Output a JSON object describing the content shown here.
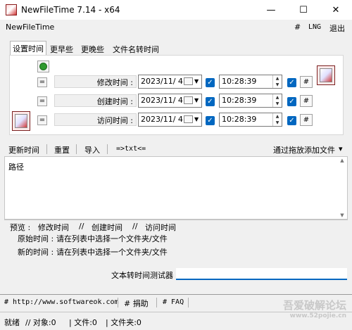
{
  "window": {
    "title": "NewFileTime 7.14 - x64",
    "minimize": "—",
    "maximize": "☐",
    "close": "✕"
  },
  "menu": {
    "app_name": "NewFileTime",
    "hash": "#",
    "lng": "LNG",
    "exit": "退出"
  },
  "tabs": [
    "设置时间",
    "更早些",
    "更晚些",
    "文件名转时间"
  ],
  "rows": [
    {
      "eq": "=",
      "label": "修改时间 :",
      "date": "2023/11/  4",
      "time": "10:28:39",
      "hash": "#"
    },
    {
      "eq": "=",
      "label": "创建时间 :",
      "date": "2023/11/  4",
      "time": "10:28:39",
      "hash": "#"
    },
    {
      "eq": "=",
      "label": "访问时间 :",
      "date": "2023/11/  4",
      "time": "10:28:39",
      "hash": "#"
    }
  ],
  "toolbar": {
    "update": "更新时间",
    "reset": "重置",
    "import": "导入",
    "txt": "=>txt<=",
    "drag_add": "通过拖放添加文件",
    "drag_arrow": "▾"
  },
  "list": {
    "header": "路径"
  },
  "preview": {
    "label": "预览 :",
    "col1": "修改时间",
    "sep1": "//",
    "col2": "创建时间",
    "sep2": "//",
    "col3": "访问时间",
    "orig_label": "原始时间 :",
    "orig_value": "请在列表中选择一个文件夹/文件",
    "new_label": "新的时间 :",
    "new_value": "请在列表中选择一个文件夹/文件"
  },
  "tester": {
    "label": "文本转时间测试器",
    "value": ""
  },
  "footer": {
    "site": "# http://www.softwareok.com",
    "donate": "# 捐助",
    "faq": "# FAQ",
    "watermark1": "吾爱破解论坛",
    "watermark2": "www.52pojie.cn"
  },
  "status": {
    "ready": "就绪",
    "objects": "// 对象:0",
    "files": "| 文件:0",
    "folders": "| 文件夹:0"
  },
  "colors": {
    "accent": "#0067c0",
    "window_bg": "#f0f0f0"
  }
}
